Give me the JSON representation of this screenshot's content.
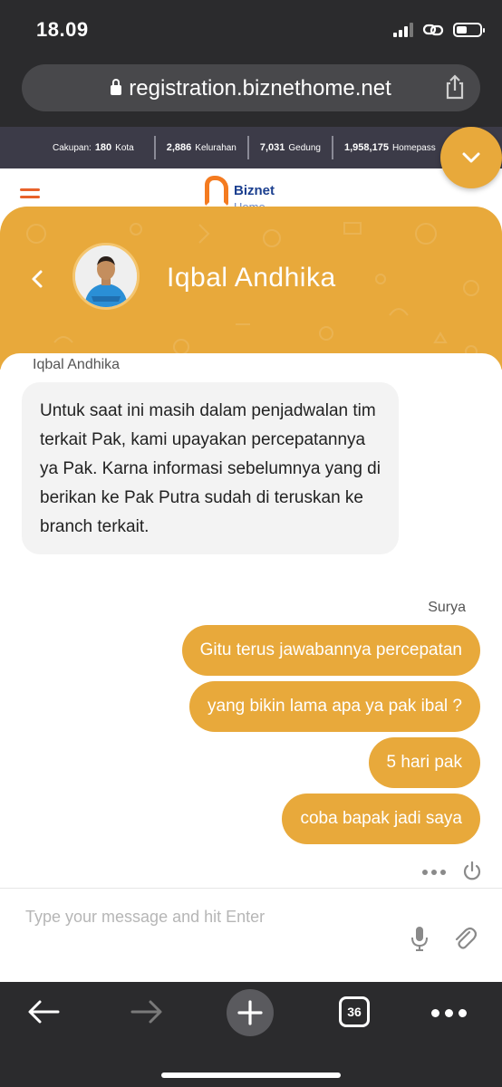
{
  "status_bar": {
    "time": "18.09",
    "battery_level": 0.45
  },
  "browser": {
    "url": "registration.biznethome.net",
    "open_tabs": "36"
  },
  "site": {
    "stats": [
      {
        "label": "Cakupan:",
        "value": "180",
        "unit": "Kota"
      },
      {
        "label": "",
        "value": "2,886",
        "unit": "Kelurahan"
      },
      {
        "label": "",
        "value": "7,031",
        "unit": "Gedung"
      },
      {
        "label": "",
        "value": "1,958,175",
        "unit": "Homepass"
      }
    ],
    "logo": {
      "name": "Biznet",
      "sub": "Home"
    }
  },
  "chat": {
    "agent_name": "Iqbal Andhika",
    "agent_sender_label": "Iqbal Andhika",
    "agent_message": "Untuk saat ini masih dalam penjadwalan tim terkait Pak, kami upayakan percepatannya ya Pak. Karna informasi sebelumnya yang di berikan ke Pak Putra sudah di teruskan ke branch terkait.",
    "user_sender_label": "Surya",
    "user_messages": [
      "Gitu terus jawabannya percepatan",
      "yang bikin lama apa ya pak ibal ?",
      "5 hari pak",
      "coba bapak jadi saya"
    ],
    "input_placeholder": "Type your message and hit Enter",
    "accent_color": "#e8a93b"
  }
}
